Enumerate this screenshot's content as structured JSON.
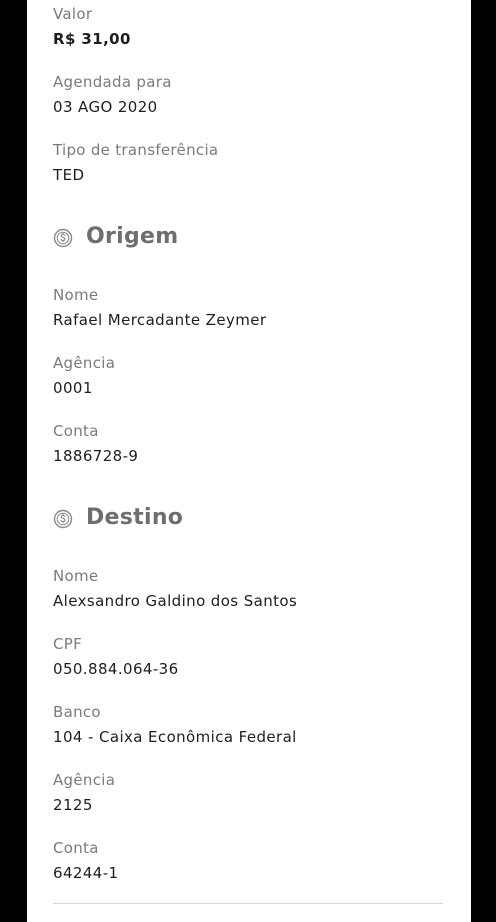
{
  "transfer": {
    "valor_label": "Valor",
    "valor_value": "R$ 31,00",
    "agendada_label": "Agendada para",
    "agendada_value": "03 AGO 2020",
    "tipo_label": "Tipo de transferência",
    "tipo_value": "TED"
  },
  "origem": {
    "title": "Origem",
    "icon": "dollar-coin-icon",
    "nome_label": "Nome",
    "nome_value": "Rafael Mercadante Zeymer",
    "agencia_label": "Agência",
    "agencia_value": "0001",
    "conta_label": "Conta",
    "conta_value": "1886728-9"
  },
  "destino": {
    "title": "Destino",
    "icon": "dollar-coin-icon",
    "nome_label": "Nome",
    "nome_value": "Alexsandro Galdino dos Santos",
    "cpf_label": "CPF",
    "cpf_value": "050.884.064-36",
    "banco_label": "Banco",
    "banco_value": "104 - Caixa Econômica Federal",
    "agencia_label": "Agência",
    "agencia_value": "2125",
    "conta_label": "Conta",
    "conta_value": "64244-1"
  },
  "colors": {
    "background": "#ffffff",
    "frame": "#000000",
    "label": "#7b7b7b",
    "value": "#1e1e1e",
    "section_title": "#6e6e6e"
  }
}
